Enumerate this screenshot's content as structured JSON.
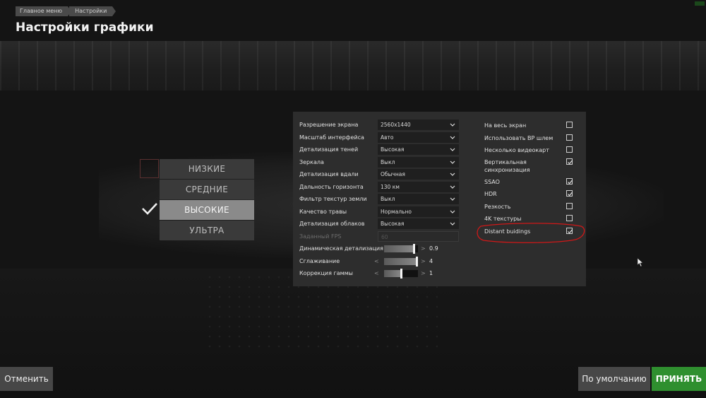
{
  "breadcrumb": [
    "Главное меню",
    "Настройки"
  ],
  "title": "Настройки графики",
  "presets": {
    "items": [
      "НИЗКИЕ",
      "СРЕДНИЕ",
      "ВЫСОКИЕ",
      "УЛЬТРА"
    ],
    "selected": "ВЫСОКИЕ"
  },
  "settings": {
    "dropdowns": [
      {
        "label": "Разрешение экрана",
        "value": "2560x1440"
      },
      {
        "label": "Масштаб интерфейса",
        "value": "Авто"
      },
      {
        "label": "Детализация теней",
        "value": "Высокая"
      },
      {
        "label": "Зеркала",
        "value": "Выкл"
      },
      {
        "label": "Детализация вдали",
        "value": "Обычная"
      },
      {
        "label": "Дальность горизонта",
        "value": "130 км"
      },
      {
        "label": "Фильтр текстур земли",
        "value": "Выкл"
      },
      {
        "label": "Качество травы",
        "value": "Нормально"
      },
      {
        "label": "Детализация облаков",
        "value": "Высокая"
      },
      {
        "label": "Заданный FPS",
        "value": "60",
        "disabled": true
      }
    ],
    "sliders": [
      {
        "label": "Динамическая детализация",
        "value": "0.9",
        "fraction": 0.9
      },
      {
        "label": "Сглаживание",
        "value": "4",
        "fraction": 1.0
      },
      {
        "label": "Коррекция гаммы",
        "value": "1",
        "fraction": 0.5
      }
    ],
    "checkboxes": [
      {
        "label": "На весь экран",
        "checked": false
      },
      {
        "label": "Использовать ВР шлем",
        "checked": false
      },
      {
        "label": "Несколько видеокарт",
        "checked": false
      },
      {
        "label": "Вертикальная синхронизация",
        "checked": true
      },
      {
        "label": "SSAO",
        "checked": true
      },
      {
        "label": "HDR",
        "checked": true
      },
      {
        "label": "Резкость",
        "checked": false
      },
      {
        "label": "4K текстуры",
        "checked": false
      },
      {
        "label": "Distant buidings",
        "checked": true
      }
    ]
  },
  "buttons": {
    "cancel": "Отменить",
    "default": "По умолчанию",
    "apply": "ПРИНЯТЬ"
  },
  "colors": {
    "apply": "#2f8f2f",
    "annotation": "#d01818"
  }
}
